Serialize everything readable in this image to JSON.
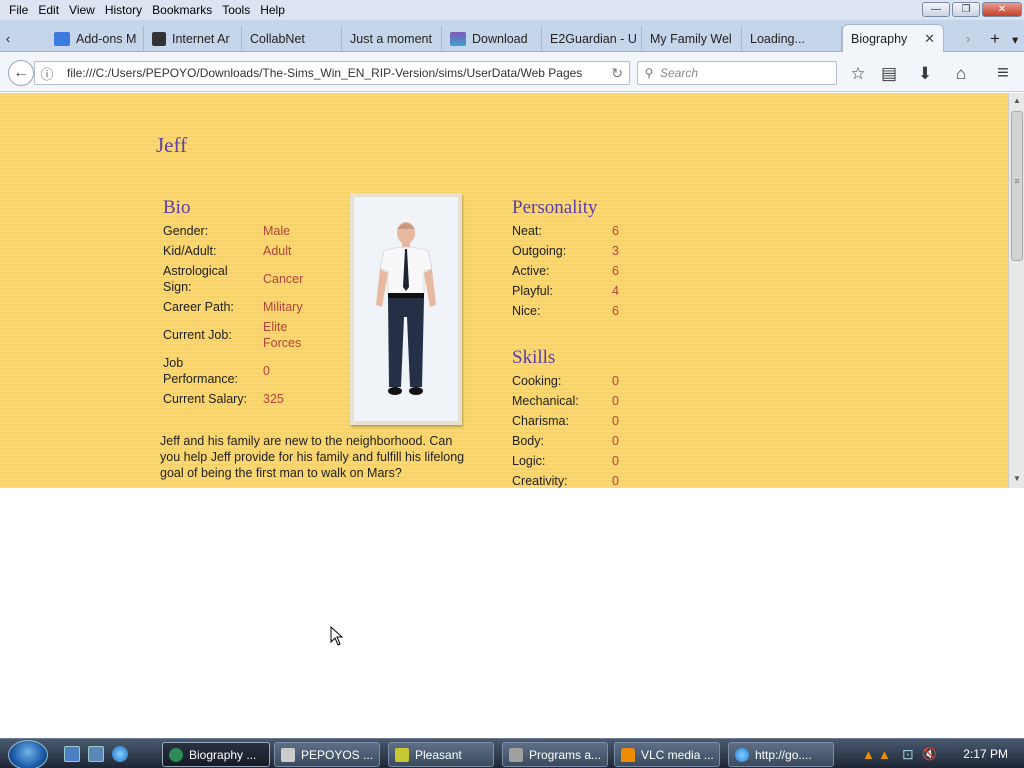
{
  "menubar": {
    "items": [
      "File",
      "Edit",
      "View",
      "History",
      "Bookmarks",
      "Tools",
      "Help"
    ]
  },
  "window_controls": {
    "minimize": "—",
    "maximize": "❐",
    "close": "✕"
  },
  "tabs": [
    {
      "label": "Add-ons M",
      "color": "#3d7be0"
    },
    {
      "label": "Internet Ar",
      "color": "#333333"
    },
    {
      "label": "CollabNet",
      "color": ""
    },
    {
      "label": "Just a moment",
      "color": ""
    },
    {
      "label": "Download",
      "color": "#7e5ab8"
    },
    {
      "label": "E2Guardian - U",
      "color": ""
    },
    {
      "label": "My Family Wel",
      "color": ""
    },
    {
      "label": "Loading...",
      "color": ""
    },
    {
      "label": "Biography",
      "color": "",
      "active": true
    }
  ],
  "tab_controls": {
    "scroll_left": "‹",
    "scroll_right": "›",
    "new_tab": "+",
    "list": "▾",
    "close_tab": "✕"
  },
  "nav": {
    "back": "←",
    "info": "ⓘ",
    "url": "file:///C:/Users/PEPOYO/Downloads/The-Sims_Win_EN_RIP-Version/sims/UserData/Web Pages",
    "reload": "↻",
    "search_placeholder": "Search",
    "search_icon": "⚲",
    "bookmark_star": "☆",
    "reading_list": "▤",
    "download": "⬇",
    "home": "⌂",
    "menu": "≡"
  },
  "page": {
    "name": "Jeff",
    "bio": {
      "heading": "Bio",
      "rows": [
        {
          "label": "Gender:",
          "value": "Male"
        },
        {
          "label": "Kid/Adult:",
          "value": "Adult"
        },
        {
          "label": "Astrological Sign:",
          "value": "Cancer"
        },
        {
          "label": "Career Path:",
          "value": "Military"
        },
        {
          "label": "Current Job:",
          "value": "Elite Forces"
        },
        {
          "label": "Job Performance:",
          "value": "0"
        },
        {
          "label": "Current Salary:",
          "value": "325"
        }
      ]
    },
    "description": "Jeff and his family are new to the neighborhood. Can you help Jeff provide for his family and fulfill his lifelong goal of being the first man to walk on Mars?",
    "personality": {
      "heading": "Personality",
      "rows": [
        {
          "label": "Neat:",
          "value": "6"
        },
        {
          "label": "Outgoing:",
          "value": "3"
        },
        {
          "label": "Active:",
          "value": "6"
        },
        {
          "label": "Playful:",
          "value": "4"
        },
        {
          "label": "Nice:",
          "value": "6"
        }
      ]
    },
    "skills": {
      "heading": "Skills",
      "rows": [
        {
          "label": "Cooking:",
          "value": "0"
        },
        {
          "label": "Mechanical:",
          "value": "0"
        },
        {
          "label": "Charisma:",
          "value": "0"
        },
        {
          "label": "Body:",
          "value": "0"
        },
        {
          "label": "Logic:",
          "value": "0"
        },
        {
          "label": "Creativity:",
          "value": "0"
        }
      ]
    },
    "scroll": {
      "up": "▲",
      "down": "▼",
      "grip": "≡"
    }
  },
  "taskbar": {
    "tasks": [
      {
        "label": "Biography ...",
        "active": true,
        "color": "#2e8b57"
      },
      {
        "label": "PEPOYOS ...",
        "color": "#cccccc"
      },
      {
        "label": "Pleasant",
        "color": "#c8c832"
      },
      {
        "label": "Programs a...",
        "color": "#a0a0a0"
      },
      {
        "label": "VLC media ...",
        "color": "#f08c00"
      },
      {
        "label": "http://go....",
        "color": "#2a7bd8"
      }
    ],
    "clock": "2:17 PM",
    "tray_icons": {
      "vlc1": "▲",
      "vlc2": "▲",
      "network": "⊡",
      "volume": "🔇"
    }
  }
}
